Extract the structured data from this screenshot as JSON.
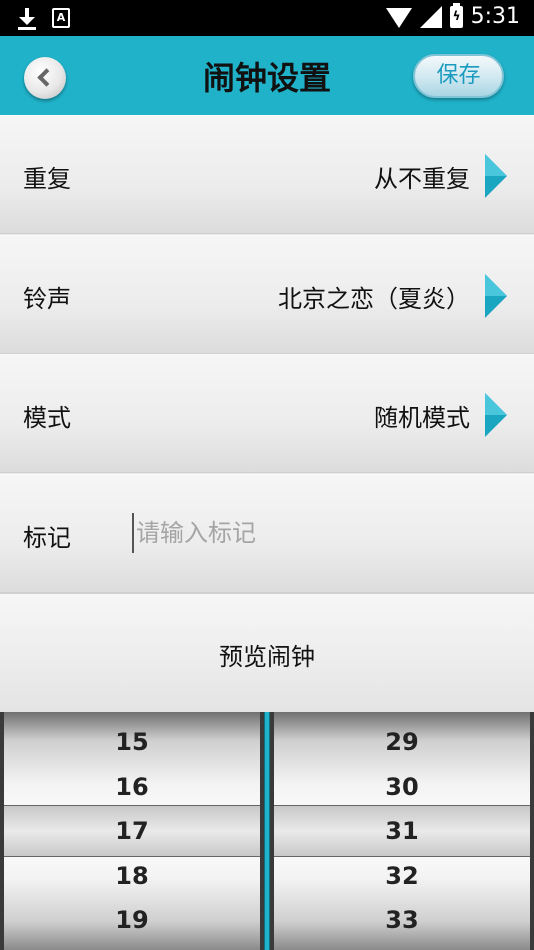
{
  "status_bar": {
    "time": "5:31",
    "icons": [
      "download-icon",
      "font-a-icon",
      "wifi-icon",
      "signal-icon",
      "battery-icon"
    ],
    "a_glyph": "A"
  },
  "header": {
    "title": "闹钟设置",
    "save_label": "保存",
    "back_icon": "chevron-left-icon"
  },
  "rows": {
    "repeat": {
      "label": "重复",
      "value": "从不重复"
    },
    "ringtone": {
      "label": "铃声",
      "value": "北京之恋（夏炎）"
    },
    "mode": {
      "label": "模式",
      "value": "随机模式"
    },
    "note": {
      "label": "标记",
      "placeholder": "请输入标记",
      "value": ""
    }
  },
  "preview": {
    "label": "预览闹钟"
  },
  "picker": {
    "hours": [
      "15",
      "16",
      "17",
      "18",
      "19"
    ],
    "minutes": [
      "29",
      "30",
      "31",
      "32",
      "33"
    ],
    "selected_hour": "17",
    "selected_minute": "31"
  },
  "colors": {
    "accent": "#1fb2c9",
    "arrow": "#1aa5c0",
    "save_text": "#1a9bbf"
  }
}
